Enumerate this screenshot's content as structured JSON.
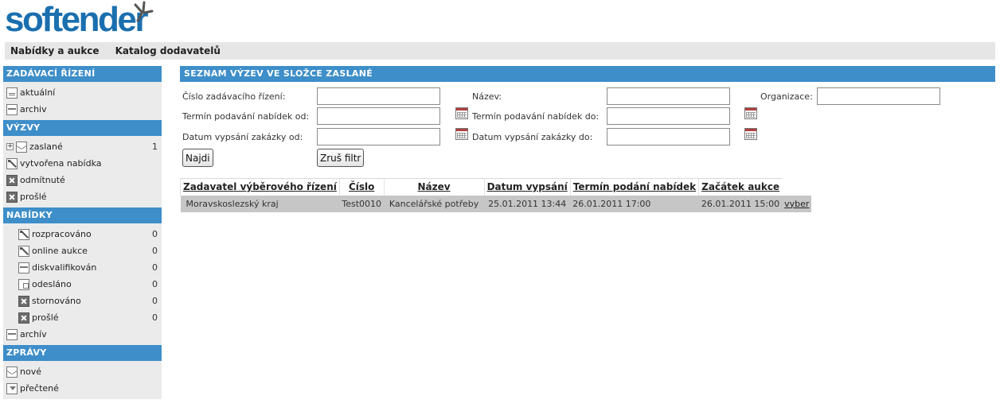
{
  "logo": {
    "text": "softender"
  },
  "topmenu": {
    "items": [
      "Nabídky a aukce",
      "Katalog dodavatelů"
    ]
  },
  "sidebar": {
    "sections": [
      {
        "title": "ZADÁVACÍ ŘÍZENÍ",
        "items": [
          {
            "label": "aktuální",
            "icon": "document-icon"
          },
          {
            "label": "archiv",
            "icon": "archive-icon"
          }
        ]
      },
      {
        "title": "VÝZVY",
        "items": [
          {
            "label": "zaslané",
            "icon": "envelope-icon",
            "count": "1"
          },
          {
            "label": "vytvořena nabídka",
            "icon": "edit-icon"
          },
          {
            "label": "odmítnuté",
            "icon": "x-icon"
          },
          {
            "label": "prošlé",
            "icon": "x-icon"
          }
        ]
      },
      {
        "title": "NABÍDKY",
        "items": [
          {
            "label": "rozpracováno",
            "icon": "edit-icon",
            "count": "0"
          },
          {
            "label": "online aukce",
            "icon": "edit-icon",
            "count": "0"
          },
          {
            "label": "diskvalifikován",
            "icon": "archive-icon",
            "count": "0"
          },
          {
            "label": "odesláno",
            "icon": "send-icon",
            "count": "0"
          },
          {
            "label": "stornováno",
            "icon": "x-icon",
            "count": "0"
          },
          {
            "label": "prošlé",
            "icon": "x-icon",
            "count": "0"
          },
          {
            "label": "archív",
            "icon": "archive-icon"
          }
        ]
      },
      {
        "title": "ZPRÁVY",
        "items": [
          {
            "label": "nové",
            "icon": "envelope-icon"
          },
          {
            "label": "přečtené",
            "icon": "read-icon"
          }
        ]
      }
    ]
  },
  "main": {
    "title": "SEZNAM VÝZEV VE SLOŽCE ZASLANÉ",
    "filters": {
      "cislo_label": "Číslo zadávacího řízení:",
      "nazev_label": "Název:",
      "organizace_label": "Organizace:",
      "termin_od_label": "Termín podavání nabídek od:",
      "termin_do_label": "Termín podavání nabídek do:",
      "datum_od_label": "Datum vypsání zakázky od:",
      "datum_do_label": "Datum vypsání zakázky do:",
      "cislo_value": "",
      "nazev_value": "",
      "organizace_value": "",
      "termin_od_value": "",
      "termin_do_value": "",
      "datum_od_value": "",
      "datum_do_value": ""
    },
    "buttons": {
      "search": "Najdi",
      "reset": "Zruš filtr"
    },
    "table": {
      "headers": [
        "Zadavatel výběrového řízení",
        "Číslo",
        "Název",
        "Datum vypsání",
        "Termín podání nabídek",
        "Začátek aukce"
      ],
      "rows": [
        {
          "zadavatel": "Moravskoslezský kraj",
          "cislo": "Test0010",
          "nazev": "Kancelářské potřeby",
          "datum": "25.01.2011 13:44",
          "termin": "26.01.2011 17:00",
          "zacatek": "26.01.2011 15:00",
          "action": "vyber"
        }
      ]
    }
  },
  "colors": {
    "header_blue": "#3d8ec9",
    "logo_blue": "#1a6fae",
    "sidebar_bg": "#ebebeb",
    "row_bg": "#c6c6c6"
  }
}
